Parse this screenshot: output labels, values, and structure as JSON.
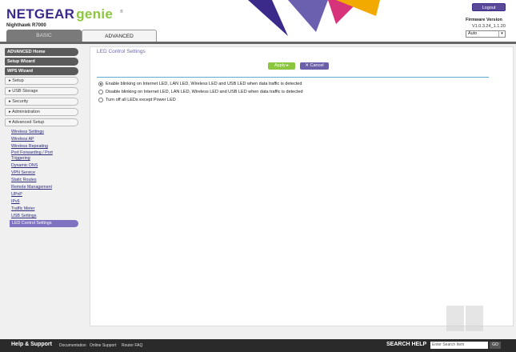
{
  "header": {
    "brand": "NETGEAR",
    "product": "genie",
    "trademark": "®",
    "model": "Nighthawk R7000",
    "logout_label": "Logout",
    "firmware_label": "Firmware Version",
    "firmware_version": "V1.0.3.24_1.1.20",
    "language_value": "Auto"
  },
  "tabs": [
    {
      "label": "BASIC",
      "active": false
    },
    {
      "label": "ADVANCED",
      "active": true
    }
  ],
  "sidebar": {
    "main_items": [
      "ADVANCED Home",
      "Setup Wizard",
      "WPS Wizard"
    ],
    "sections": [
      "Setup",
      "USB Storage",
      "Security",
      "Administration",
      "Advanced Setup"
    ],
    "section_markers": [
      "▸",
      "▸",
      "▸",
      "▸",
      "▾"
    ],
    "links": [
      "Wireless Settings",
      "Wireless AP",
      "Wireless Repeating",
      "Port Forwarding / Port Triggering",
      "Dynamic DNS",
      "VPN Service",
      "Static Routes",
      "Remote Management",
      "UPnP",
      "IPv6",
      "Traffic Meter",
      "USB Settings",
      "LED Control Settings"
    ],
    "active_link": "LED Control Settings"
  },
  "content": {
    "title": "LED Control Settings",
    "apply_label": "Apply ▸",
    "cancel_label": "✕ Cancel",
    "options": [
      {
        "label": "Enable blinking on Internet LED, LAN LED, Wireless LED and USB LED when data traffic is detected",
        "checked": true
      },
      {
        "label": "Disable blinking on Internet LED, LAN LED, Wireless LED and USB LED when data traffic is detected",
        "checked": false
      },
      {
        "label": "Turn off all LEDs except Power LED",
        "checked": false
      }
    ]
  },
  "footer": {
    "help_title": "Help & Support",
    "links": [
      "Documentation",
      "Online Support",
      "Router FAQ"
    ],
    "search_label": "SEARCH HELP",
    "search_placeholder": "Enter Search Item",
    "go_label": "GO"
  },
  "colors": {
    "brand_purple": "#3c2a8a",
    "genie_green": "#8cc63f",
    "active_link": "#7f72c0"
  }
}
